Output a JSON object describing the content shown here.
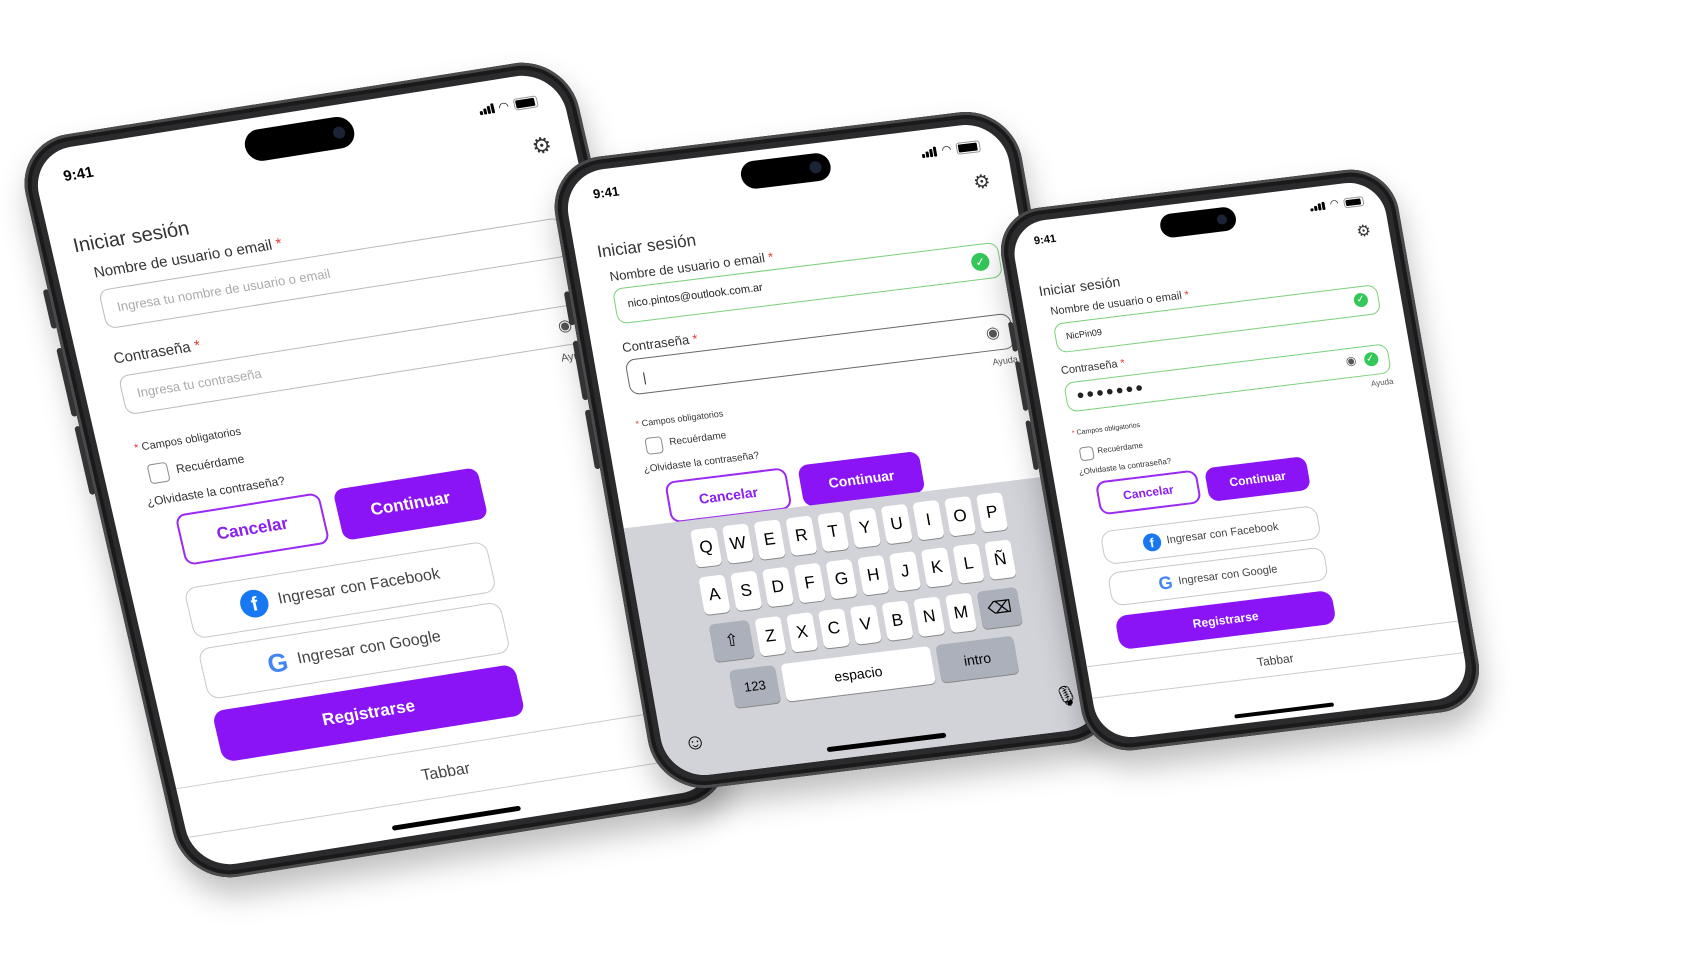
{
  "status_time": "9:41",
  "screen_title": "Iniciar sesión",
  "username_label": "Nombre de usuario o email",
  "required_mark": "*",
  "password_label": "Contraseña",
  "help_link": "Ayuda",
  "required_note": "Campos obligatorios",
  "remember_label": "Recuérdame",
  "forgot_link": "¿Olvidaste la contraseña?",
  "cancel_label": "Cancelar",
  "continue_label": "Continuar",
  "facebook_label": "Ingresar con Facebook",
  "google_label": "Ingresar con Google",
  "register_label": "Registrarse",
  "tabbar_label": "Tabbar",
  "phones": [
    {
      "username_placeholder": "Ingresa tu nombre de usuario o email",
      "password_placeholder": "Ingresa tu contraseña"
    },
    {
      "username_value": "nico.pintos@outlook.com.ar"
    },
    {
      "username_value": "NicPin09",
      "password_value": "●●●●●●●"
    }
  ],
  "keyboard": {
    "row1": [
      "Q",
      "W",
      "E",
      "R",
      "T",
      "Y",
      "U",
      "I",
      "O",
      "P"
    ],
    "row2": [
      "A",
      "S",
      "D",
      "F",
      "G",
      "H",
      "J",
      "K",
      "L",
      "Ñ"
    ],
    "row3": [
      "Z",
      "X",
      "C",
      "V",
      "B",
      "N",
      "M"
    ],
    "numbers_key": "123",
    "space_key": "espacio",
    "return_key": "intro",
    "shift_icon": "shift-icon",
    "delete_icon": "delete-icon",
    "emoji_icon": "emoji-icon",
    "mic_icon": "microphone-icon"
  },
  "colors": {
    "primary": "#8a14f5",
    "success": "#34c759",
    "required": "#e53935"
  }
}
